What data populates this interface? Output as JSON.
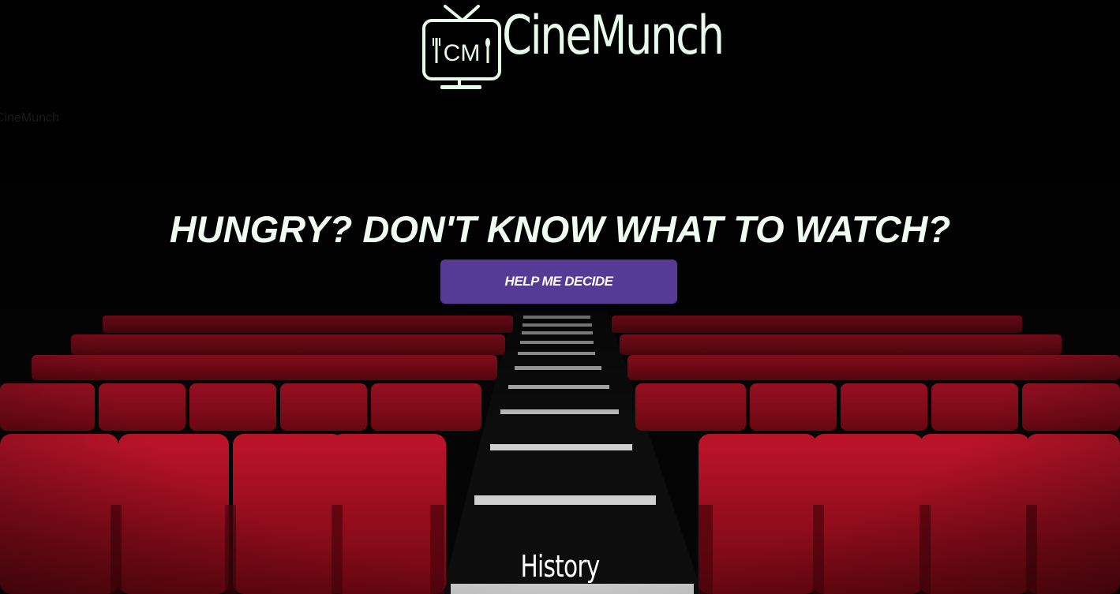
{
  "brand": {
    "logo_text": "CineMunch",
    "logo_badge_text": "CM",
    "alt_text": "CineMunch"
  },
  "hero": {
    "headline": "HUNGRY? DON'T KNOW WHAT TO WATCH?",
    "cta_label": "HELP ME DECIDE"
  },
  "nav": {
    "history_label": "History"
  },
  "colors": {
    "accent": "#553a96",
    "logo": "#e6fbe8",
    "seats": "#a3101c",
    "background": "#000000"
  }
}
